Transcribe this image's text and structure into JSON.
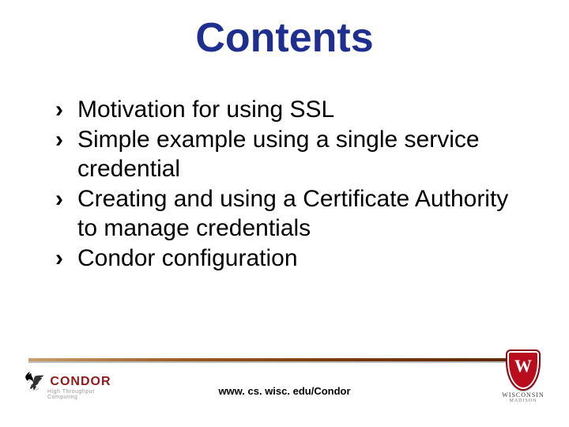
{
  "title": "Contents",
  "bullet_glyph": "›",
  "items": [
    "Motivation for using SSL",
    "Simple example using a single service credential",
    "Creating and using a Certificate Authority to manage credentials",
    "Condor configuration"
  ],
  "footer_url": "www. cs. wisc. edu/Condor",
  "logo_left": {
    "text": "CONDOR",
    "subtitle": "High Throughput Computing"
  },
  "logo_right": {
    "top": "WISCONSIN",
    "bottom": "MADISON"
  }
}
